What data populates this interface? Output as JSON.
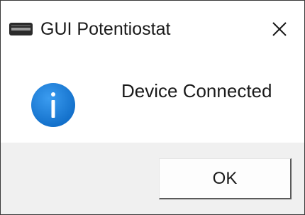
{
  "window": {
    "title": "GUI Potentiostat",
    "app_icon": "app-window-icon",
    "close_icon": "close-icon"
  },
  "dialog": {
    "icon": "info-icon",
    "message": "Device Connected",
    "ok_label": "OK"
  },
  "colors": {
    "info_blue": "#1a7fd9",
    "footer_bg": "#f0f0f0",
    "text": "#1a1a1a"
  }
}
